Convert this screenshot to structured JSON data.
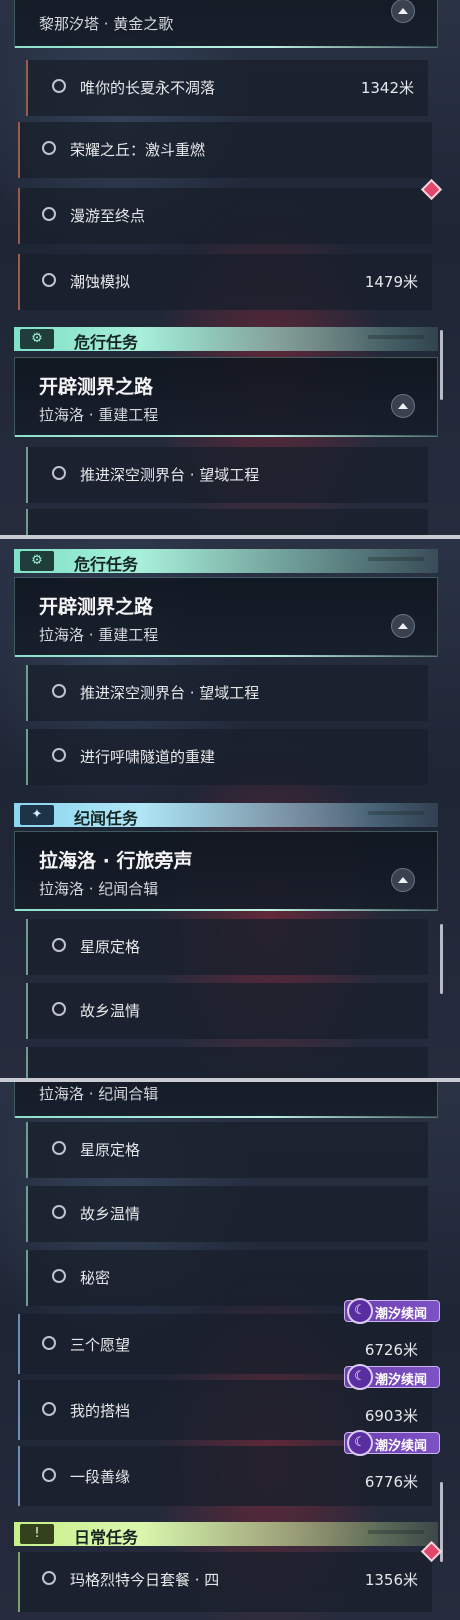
{
  "colors": {
    "danger_accent": "#7fe0c8",
    "companion_accent": "#8ad6f0",
    "daily_accent": "#c8f08a",
    "tag_purple": "#6c3fb0",
    "marker_red": "#e0476a"
  },
  "icons": {
    "danger": "gear-badge-icon",
    "companion": "sparkle-icon",
    "daily": "exclamation-icon",
    "tag": "moon-stone-icon",
    "collapse": "chevron-up-icon"
  },
  "panel1": {
    "top_fragment": "黎那汐塔 · 黄金之歌",
    "row1": {
      "label": "唯你的长夏永不凋落",
      "distance": "1342米"
    },
    "row2": {
      "label": "荣耀之丘：激斗重燃"
    },
    "row3": {
      "label": "漫游至终点"
    },
    "row4": {
      "label": "潮蚀模拟",
      "distance": "1479米"
    },
    "category": "危行任务",
    "card": {
      "title": "开辟测界之路",
      "subtitle": "拉海洛 · 重建工程"
    },
    "sub1": {
      "label": "推进深空测界台 · 望域工程"
    }
  },
  "panel2": {
    "category1": "危行任务",
    "card1": {
      "title": "开辟测界之路",
      "subtitle": "拉海洛 · 重建工程"
    },
    "sub1": {
      "label": "推进深空测界台 · 望域工程"
    },
    "sub2": {
      "label": "进行呼啸隧道的重建"
    },
    "category2": "纪闻任务",
    "card2": {
      "title": "拉海洛 · 行旅旁声",
      "subtitle": "拉海洛 · 纪闻合辑"
    },
    "sub3": {
      "label": "星原定格"
    },
    "sub4": {
      "label": "故乡温情"
    }
  },
  "panel3": {
    "top_fragment": "拉海洛 · 纪闻合辑",
    "sub1": {
      "label": "星原定格"
    },
    "sub2": {
      "label": "故乡温情"
    },
    "sub3": {
      "label": "秘密"
    },
    "row1": {
      "label": "三个愿望",
      "distance": "6726米",
      "tag": "潮汐续闻"
    },
    "row2": {
      "label": "我的搭档",
      "distance": "6903米",
      "tag": "潮汐续闻"
    },
    "row3": {
      "label": "一段善缘",
      "distance": "6776米",
      "tag": "潮汐续闻"
    },
    "category": "日常任务",
    "row4": {
      "label": "玛格烈特今日套餐 · 四",
      "distance": "1356米"
    }
  }
}
